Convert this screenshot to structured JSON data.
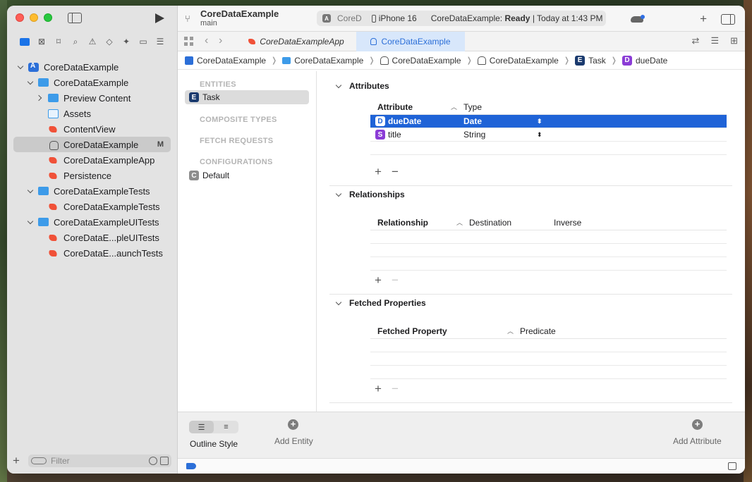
{
  "window": {
    "project_name": "CoreDataExample",
    "branch": "main",
    "status": {
      "scheme": "CoreD",
      "device": "iPhone 16",
      "message_prefix": "CoreDataExample: ",
      "message_state": "Ready",
      "message_suffix": " | Today at 1:43 PM"
    }
  },
  "sidebar": {
    "tree": [
      {
        "label": "CoreDataExample",
        "icon": "project-icon",
        "level": 0,
        "expanded": true
      },
      {
        "label": "CoreDataExample",
        "icon": "folder-icon",
        "level": 1,
        "expanded": true
      },
      {
        "label": "Preview Content",
        "icon": "folder-icon",
        "level": 2,
        "expanded": false
      },
      {
        "label": "Assets",
        "icon": "assets-icon",
        "level": 2
      },
      {
        "label": "ContentView",
        "icon": "swift-icon",
        "level": 2
      },
      {
        "label": "CoreDataExample",
        "icon": "data-model-icon",
        "level": 2,
        "selected": true,
        "badge": "M"
      },
      {
        "label": "CoreDataExampleApp",
        "icon": "swift-icon",
        "level": 2
      },
      {
        "label": "Persistence",
        "icon": "swift-icon",
        "level": 2
      },
      {
        "label": "CoreDataExampleTests",
        "icon": "folder-icon",
        "level": 1,
        "expanded": true
      },
      {
        "label": "CoreDataExampleTests",
        "icon": "swift-icon",
        "level": 2
      },
      {
        "label": "CoreDataExampleUITests",
        "icon": "folder-icon",
        "level": 1,
        "expanded": true
      },
      {
        "label": "CoreDataE...pleUITests",
        "icon": "swift-icon",
        "level": 2
      },
      {
        "label": "CoreDataE...aunchTests",
        "icon": "swift-icon",
        "level": 2
      }
    ],
    "filter_placeholder": "Filter"
  },
  "tabs": [
    {
      "label": "CoreDataExampleApp",
      "active": false
    },
    {
      "label": "CoreDataExample",
      "active": true
    }
  ],
  "breadcrumb": [
    {
      "label": "CoreDataExample",
      "icon": "project-icon"
    },
    {
      "label": "CoreDataExample",
      "icon": "folder-icon"
    },
    {
      "label": "CoreDataExample",
      "icon": "data-model-icon"
    },
    {
      "label": "CoreDataExample",
      "icon": "data-model-version-icon"
    },
    {
      "label": "Task",
      "letter": "E"
    },
    {
      "label": "dueDate",
      "letter": "D"
    }
  ],
  "entities_pane": {
    "entities_header": "ENTITIES",
    "entities": [
      {
        "letter": "E",
        "label": "Task"
      }
    ],
    "composite_header": "COMPOSITE TYPES",
    "fetch_header": "FETCH REQUESTS",
    "config_header": "CONFIGURATIONS",
    "configurations": [
      {
        "letter": "C",
        "label": "Default"
      }
    ]
  },
  "attributes": {
    "title": "Attributes",
    "col_attribute": "Attribute",
    "col_type": "Type",
    "rows": [
      {
        "letter": "D",
        "name": "dueDate",
        "type": "Date",
        "selected": true
      },
      {
        "letter": "S",
        "name": "title",
        "type": "String",
        "selected": false
      }
    ]
  },
  "relationships": {
    "title": "Relationships",
    "col_relationship": "Relationship",
    "col_destination": "Destination",
    "col_inverse": "Inverse"
  },
  "fetched_properties": {
    "title": "Fetched Properties",
    "col_property": "Fetched Property",
    "col_predicate": "Predicate"
  },
  "bottom": {
    "outline_style": "Outline Style",
    "add_entity": "Add Entity",
    "add_attribute": "Add Attribute"
  }
}
